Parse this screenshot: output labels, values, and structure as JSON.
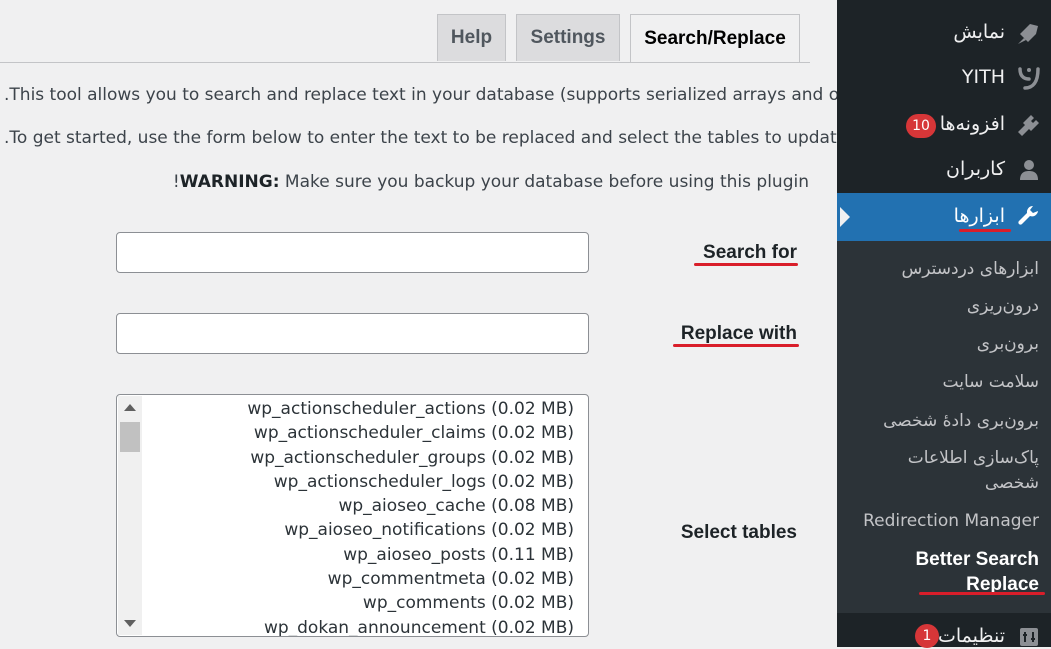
{
  "tabs": {
    "help": "Help",
    "settings": "Settings",
    "search_replace": "Search/Replace"
  },
  "intro": {
    "line1": ".This tool allows you to search and replace text in your database (supports serialized arrays and objects)",
    "line2": ".To get started, use the form below to enter the text to be replaced and select the tables to update",
    "warning_prefix": "!",
    "warning_label": "WARNING:",
    "warning_text": " Make sure you backup your database before using this plugin"
  },
  "form": {
    "search_label": "Search for",
    "replace_label": "Replace with",
    "tables_label": "Select tables",
    "search_value": "",
    "replace_value": "",
    "tables": [
      "wp_actionscheduler_actions (0.02 MB)",
      "wp_actionscheduler_claims (0.02 MB)",
      "wp_actionscheduler_groups (0.02 MB)",
      "wp_actionscheduler_logs (0.02 MB)",
      "wp_aioseo_cache (0.08 MB)",
      "wp_aioseo_notifications (0.02 MB)",
      "wp_aioseo_posts (0.11 MB)",
      "wp_commentmeta (0.02 MB)",
      "wp_comments (0.02 MB)",
      "wp_dokan_announcement (0.02 MB)"
    ]
  },
  "sidebar": {
    "appearance": "نمایش",
    "yith": "YITH",
    "plugins": "افزونه‌ها",
    "plugins_badge": "10",
    "users": "کاربران",
    "tools": "ابزارها",
    "submenu": {
      "available_tools": "ابزارهای دردسترس",
      "import": "درون‌ریزی",
      "export": "برون‌بری",
      "site_health": "سلامت سایت",
      "export_personal_data": "برون‌بری دادهٔ شخصی",
      "erase_personal_data_1": "پاک‌سازی اطلاعات",
      "erase_personal_data_2": "شخصی",
      "redirection": "Redirection Manager",
      "bsr_1": "Better Search",
      "bsr_2": "Replace"
    },
    "settings": "تنظیمات",
    "settings_badge": "1"
  },
  "colors": {
    "sidebar_bg": "#1d2327",
    "active_menu": "#2271b1",
    "badge": "#d63638",
    "underline": "#d91e2a"
  }
}
